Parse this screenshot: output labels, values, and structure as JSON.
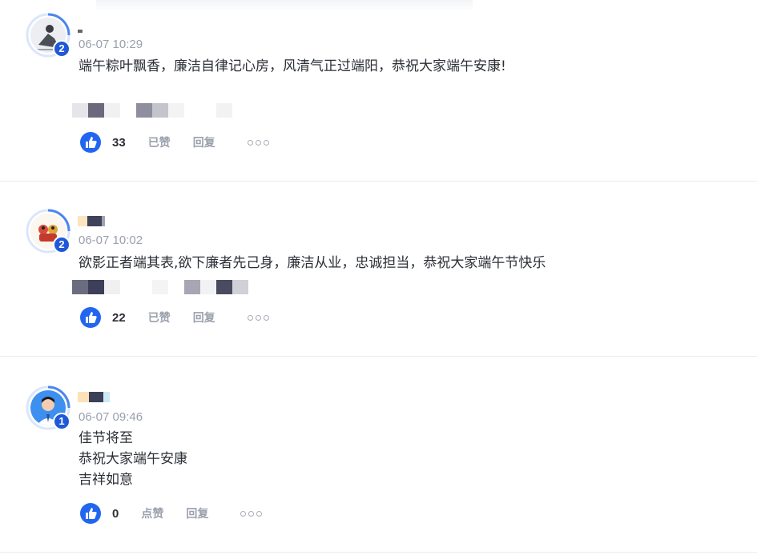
{
  "comments": [
    {
      "level": "2",
      "time": "06-07 10:29",
      "lines": [
        "端午粽叶飘香，廉洁自律记心房，风清气正过端阳，恭祝大家端午安康!"
      ],
      "likes": "33",
      "like_action": "已赞",
      "reply_label": "回复"
    },
    {
      "level": "2",
      "time": "06-07 10:02",
      "lines": [
        "欲影正者端其表,欲下廉者先己身，廉洁从业，忠诚担当，恭祝大家端午节快乐"
      ],
      "likes": "22",
      "like_action": "已赞",
      "reply_label": "回复"
    },
    {
      "level": "1",
      "time": "06-07 09:46",
      "lines": [
        "佳节将至",
        "恭祝大家端午安康",
        "吉祥如意"
      ],
      "likes": "0",
      "like_action": "点赞",
      "reply_label": "回复"
    }
  ],
  "colors": {
    "accent": "#2266f0",
    "badge": "#1f58d8",
    "muted_text": "#9aa0ad"
  },
  "icons": {
    "like": "thumbs-up-icon",
    "more": "more-dots-icon"
  }
}
